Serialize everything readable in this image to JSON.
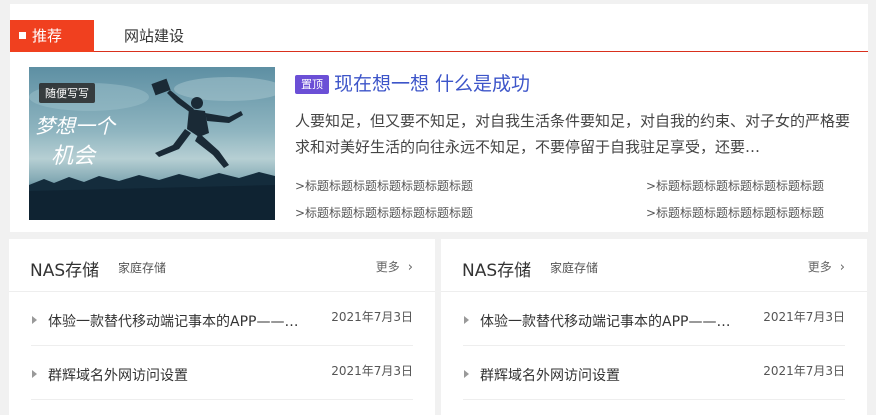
{
  "recommend": {
    "tabs": [
      {
        "label": "推荐",
        "active": true
      },
      {
        "label": "网站建设",
        "active": false
      }
    ],
    "feature": {
      "image_badge": "随便写写",
      "image_text": "梦想一个机会",
      "pin_badge": "置顶",
      "title": "现在想一想 什么是成功",
      "summary": "人要知足，但又要不知足，对自我生活条件要知足，对自我的约束、对子女的严格要求和对美好生活的向往永远不知足，不要停留于自我驻足享受，还要…"
    },
    "links": [
      ">标题标题标题标题标题标题标题",
      ">标题标题标题标题标题标题标题",
      ">标题标题标题标题标题标题标题",
      ">标题标题标题标题标题标题标题"
    ],
    "colors": {
      "accent": "#f0401f",
      "title_link": "#3d55c9",
      "pin": "#6b4fd6"
    }
  },
  "panels": [
    {
      "title": "NAS存储",
      "subtitle": "家庭存储",
      "more": "更多",
      "items": [
        {
          "title": "体验一款替代移动端记事本的APP——Memos",
          "date": "2021年7月3日"
        },
        {
          "title": "群辉域名外网访问设置",
          "date": "2021年7月3日"
        }
      ]
    },
    {
      "title": "NAS存储",
      "subtitle": "家庭存储",
      "more": "更多",
      "items": [
        {
          "title": "体验一款替代移动端记事本的APP——Memos",
          "date": "2021年7月3日"
        },
        {
          "title": "群辉域名外网访问设置",
          "date": "2021年7月3日"
        }
      ]
    }
  ],
  "icons": {
    "more": "chevron-right-icon",
    "bullet": "triangle-bullet-icon"
  }
}
